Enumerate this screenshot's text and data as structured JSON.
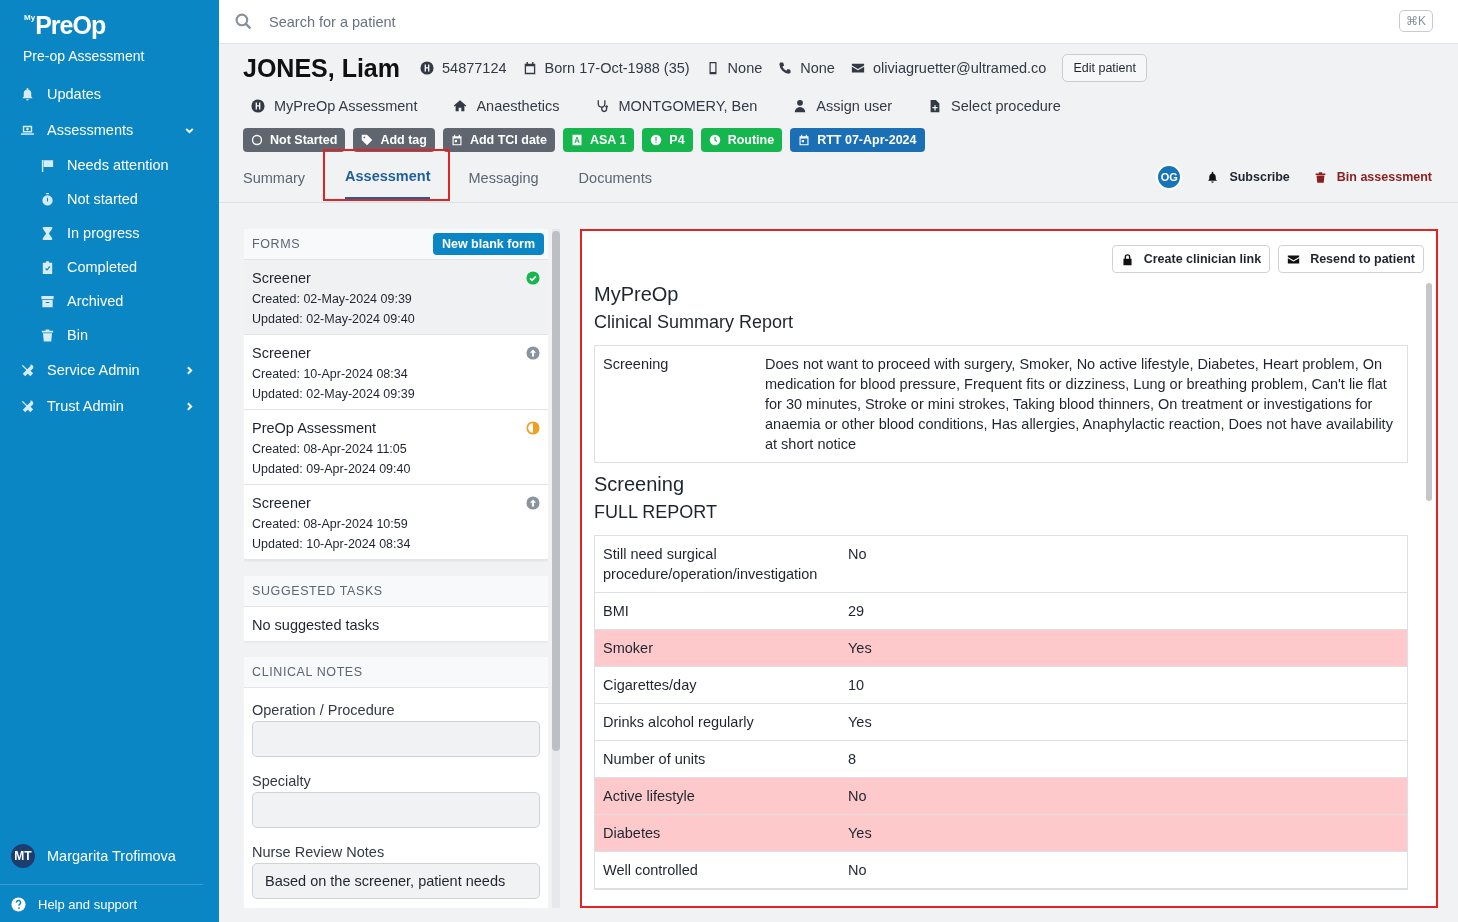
{
  "sidebar": {
    "logo_super": "My",
    "logo": "PreOp",
    "subtitle": "Pre-op Assessment",
    "items": [
      {
        "kind": "bell",
        "label": "Updates"
      },
      {
        "kind": "laptop",
        "label": "Assessments",
        "expanded": true,
        "children": [
          {
            "kind": "flag",
            "label": "Needs attention"
          },
          {
            "kind": "stopwatch",
            "label": "Not started"
          },
          {
            "kind": "hourglass",
            "label": "In progress"
          },
          {
            "kind": "clipboard",
            "label": "Completed"
          },
          {
            "kind": "archive",
            "label": "Archived"
          },
          {
            "kind": "trash",
            "label": "Bin"
          }
        ]
      },
      {
        "kind": "tools",
        "label": "Service Admin",
        "expanded": false
      },
      {
        "kind": "tools",
        "label": "Trust Admin",
        "expanded": false
      }
    ],
    "user": {
      "initials": "MT",
      "name": "Margarita Trofimova"
    },
    "help": "Help and support"
  },
  "search": {
    "placeholder": "Search for a patient",
    "shortcut": "⌘K"
  },
  "patient": {
    "name": "JONES, Liam",
    "details": [
      {
        "kind": "hospital",
        "text": "54877124"
      },
      {
        "kind": "calendar",
        "text": "Born 17-Oct-1988 (35)"
      },
      {
        "kind": "mobile",
        "text": "None"
      },
      {
        "kind": "phone",
        "text": "None"
      },
      {
        "kind": "mail",
        "text": "oliviagruetter@ultramed.co"
      }
    ],
    "edit_button": "Edit patient",
    "meta": [
      {
        "kind": "hospital",
        "text": "MyPreOp Assessment"
      },
      {
        "kind": "house",
        "text": "Anaesthetics"
      },
      {
        "kind": "stethoscope",
        "text": "MONTGOMERY, Ben"
      },
      {
        "kind": "user",
        "text": "Assign user"
      },
      {
        "kind": "file",
        "text": "Select procedure"
      }
    ],
    "badges": [
      {
        "kind": "circle",
        "text": "Not Started",
        "color": "#5f6670"
      },
      {
        "kind": "tag",
        "text": "Add tag",
        "color": "#5f6670"
      },
      {
        "kind": "calendar",
        "text": "Add TCI date",
        "color": "#5f6670"
      },
      {
        "kind": "letter",
        "text": "ASA 1",
        "color": "#16b64f"
      },
      {
        "kind": "alert",
        "text": "P4",
        "color": "#16b64f"
      },
      {
        "kind": "clock",
        "text": "Routine",
        "color": "#16b64f"
      },
      {
        "kind": "calendar",
        "text": "RTT 07-Apr-2024",
        "color": "#1a6fb5"
      }
    ]
  },
  "tabs": [
    {
      "label": "Summary",
      "selected": false,
      "highlighted": false
    },
    {
      "label": "Assessment",
      "selected": true,
      "highlighted": true
    },
    {
      "label": "Messaging",
      "selected": false,
      "highlighted": false
    },
    {
      "label": "Documents",
      "selected": false,
      "highlighted": false
    }
  ],
  "actions": {
    "avatar": "OG",
    "subscribe": "Subscribe",
    "bin": "Bin assessment"
  },
  "forms": {
    "title": "FORMS",
    "new_button": "New blank form",
    "items": [
      {
        "name": "Screener",
        "created": "Created: 02-May-2024 09:39",
        "updated": "Updated: 02-May-2024 09:40",
        "kind": "completed",
        "selected": true
      },
      {
        "name": "Screener",
        "created": "Created: 10-Apr-2024 08:34",
        "updated": "Updated: 02-May-2024 09:39",
        "kind": "sent",
        "selected": false
      },
      {
        "name": "PreOp Assessment",
        "created": "Created: 08-Apr-2024 11:05",
        "updated": "Updated: 09-Apr-2024 09:40",
        "kind": "in_progress",
        "selected": false
      },
      {
        "name": "Screener",
        "created": "Created: 08-Apr-2024 10:59",
        "updated": "Updated: 10-Apr-2024 08:34",
        "kind": "sent",
        "selected": false
      }
    ]
  },
  "suggested_tasks": {
    "title": "SUGGESTED TASKS",
    "text": "No suggested tasks"
  },
  "clinical_notes": {
    "title": "CLINICAL NOTES",
    "fields": [
      {
        "label": "Operation / Procedure"
      },
      {
        "label": "Specialty"
      },
      {
        "label": "Nurse Review Notes",
        "value": "Based on the screener, patient needs"
      }
    ]
  },
  "report": {
    "highlighted": true,
    "buttons": [
      {
        "kind": "lock",
        "label": "Create clinician link"
      },
      {
        "kind": "mail",
        "label": "Resend to patient"
      }
    ],
    "title": "MyPreOp",
    "subtitle": "Clinical Summary Report",
    "summary": [
      {
        "label": "Screening",
        "value": "Does not want to proceed with surgery, Smoker, No active lifestyle, Diabetes, Heart problem, On medication for blood pressure, Frequent fits or dizziness, Lung or breathing problem, Can't lie flat for 30 minutes, Stroke or mini strokes, Taking blood thinners, On treatment or investigations for anaemia or other blood conditions, Has allergies, Anaphylactic reaction, Does not have availability at short notice"
      }
    ],
    "section_title": "Screening",
    "section_subtitle": "FULL REPORT",
    "rows": [
      {
        "label": "Still need surgical procedure/operation/investigation",
        "value": "No",
        "flagged": false
      },
      {
        "label": "BMI",
        "value": "29",
        "flagged": false
      },
      {
        "label": "Smoker",
        "value": "Yes",
        "flagged": true
      },
      {
        "label": "Cigarettes/day",
        "value": "10",
        "flagged": false
      },
      {
        "label": "Drinks alcohol regularly",
        "value": "Yes",
        "flagged": false
      },
      {
        "label": "Number of units",
        "value": "8",
        "flagged": false
      },
      {
        "label": "Active lifestyle",
        "value": "No",
        "flagged": true
      },
      {
        "label": "Diabetes",
        "value": "Yes",
        "flagged": true
      },
      {
        "label": "Well controlled",
        "value": "No",
        "flagged": false
      }
    ]
  }
}
